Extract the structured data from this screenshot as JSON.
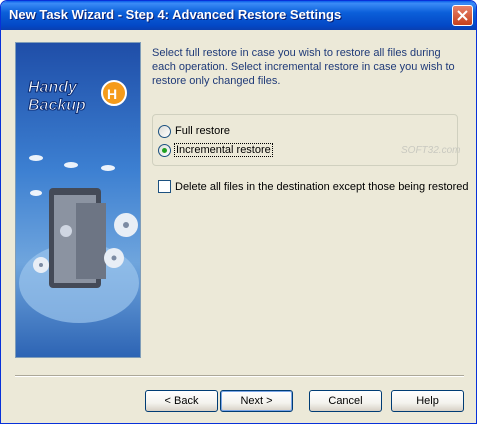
{
  "window": {
    "title": "New Task Wizard - Step 4: Advanced Restore Settings"
  },
  "banner": {
    "logo_text": "Handy Backup"
  },
  "description": "Select full restore in case you wish to restore all files during each operation. Select incremental restore in case you wish to restore only changed files.",
  "restore_mode": {
    "options": [
      {
        "label": "Full restore",
        "selected": false
      },
      {
        "label": "Incremental restore",
        "selected": true
      }
    ]
  },
  "delete_option": {
    "label": "Delete all files in the destination except those being restored",
    "checked": false
  },
  "watermark": "SOFT32.com",
  "buttons": {
    "back": "< Back",
    "next": "Next >",
    "cancel": "Cancel",
    "help": "Help"
  }
}
